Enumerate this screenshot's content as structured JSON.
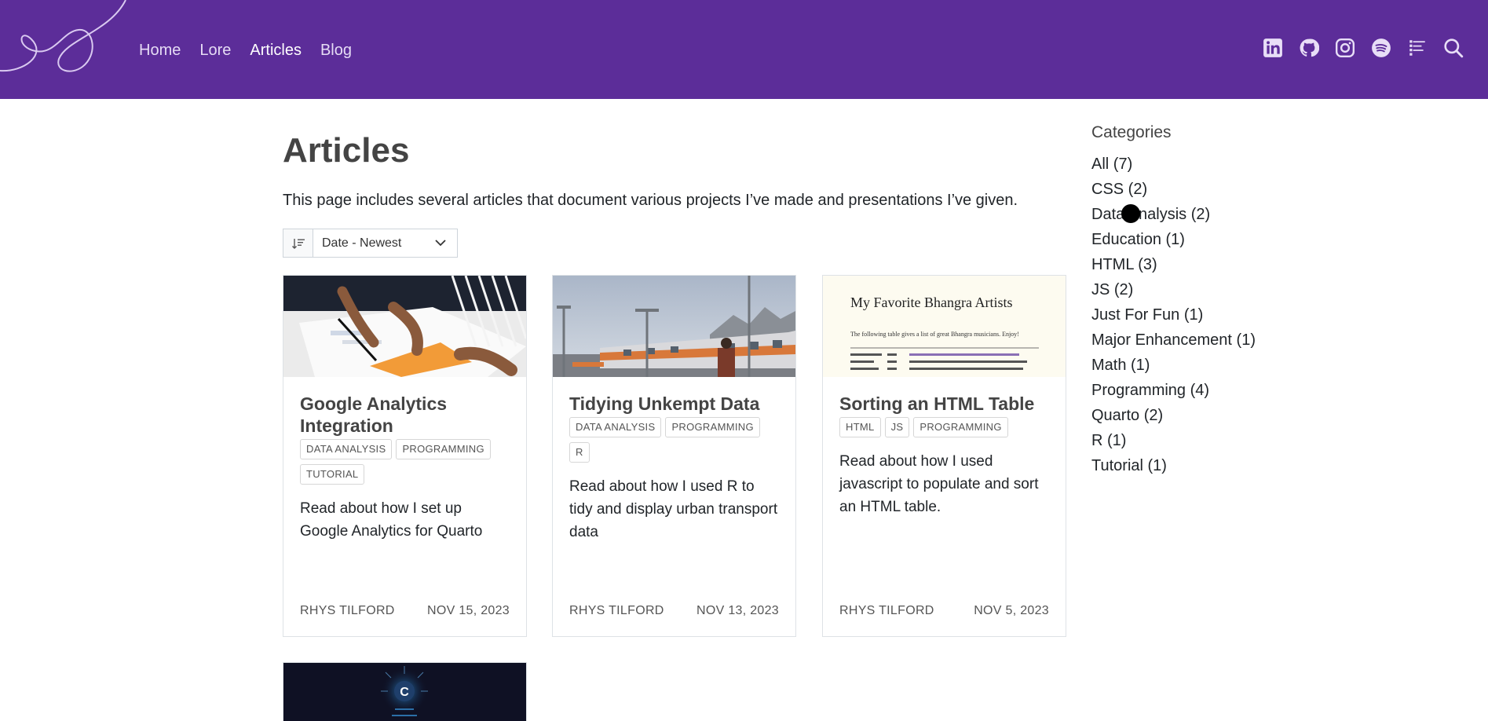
{
  "nav": {
    "links": [
      {
        "label": "Home"
      },
      {
        "label": "Lore"
      },
      {
        "label": "Articles"
      },
      {
        "label": "Blog"
      }
    ],
    "icons": [
      "linkedin-icon",
      "github-icon",
      "instagram-icon",
      "spotify-icon",
      "rss-icon",
      "search-icon"
    ],
    "bg_color": "#5c2d99"
  },
  "page": {
    "title": "Articles",
    "description": "This page includes several articles that document various projects I’ve made and presentations I’ve given."
  },
  "sort": {
    "selected": "Date - Newest"
  },
  "cards": [
    {
      "title": "Google Analytics Integration",
      "tags": [
        "DATA ANALYSIS",
        "PROGRAMMING",
        "TUTORIAL"
      ],
      "description": "Read about how I set up Google Analytics for Quarto",
      "author": "RHYS TILFORD",
      "date": "NOV 15, 2023"
    },
    {
      "title": "Tidying Unkempt Data",
      "tags": [
        "DATA ANALYSIS",
        "PROGRAMMING",
        "R"
      ],
      "description": "Read about how I used R to tidy and display urban transport data",
      "author": "RHYS TILFORD",
      "date": "NOV 13, 2023"
    },
    {
      "title": "Sorting an HTML Table",
      "tags": [
        "HTML",
        "JS",
        "PROGRAMMING"
      ],
      "description": "Read about how I used javascript to populate and sort an HTML table.",
      "author": "RHYS TILFORD",
      "date": "NOV 5, 2023",
      "image_text": {
        "heading": "My Favorite Bhangra Artists",
        "caption": "The following table gives a list of great Bhangra musicians. Enjoy!"
      }
    }
  ],
  "fourth_card_image_letter": "C",
  "sidebar": {
    "title": "Categories",
    "items": [
      "All (7)",
      "CSS (2)",
      "Data Analysis (2)",
      "Education (1)",
      "HTML (3)",
      "JS (2)",
      "Just For Fun (1)",
      "Major Enhancement (1)",
      "Math (1)",
      "Programming (4)",
      "Quarto (2)",
      "R (1)",
      "Tutorial (1)"
    ]
  }
}
